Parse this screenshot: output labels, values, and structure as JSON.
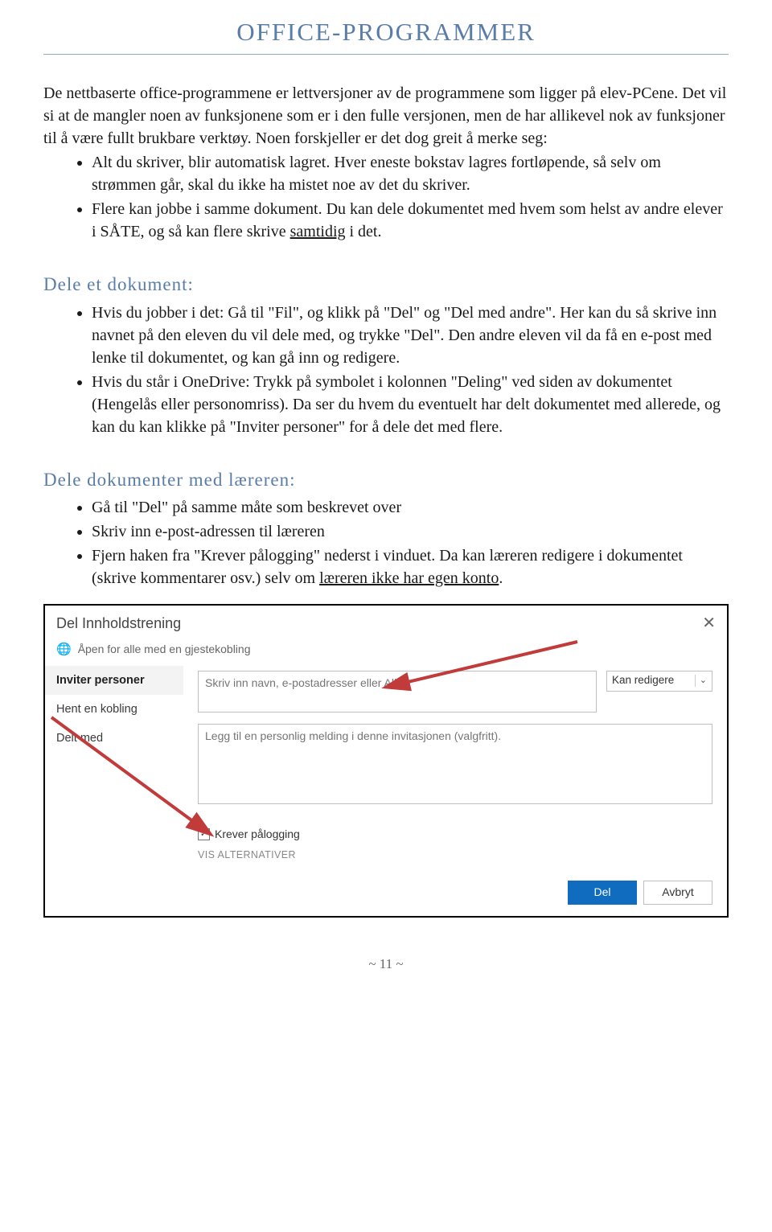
{
  "title": "OFFICE-PROGRAMMER",
  "intro": {
    "p1": "De nettbaserte office-programmene er lettversjoner av de programmene som ligger på elev-PCene. Det vil si at de mangler noen av funksjonene som er i den fulle versjonen, men de har allikevel nok av funksjoner til å være fullt brukbare verktøy. Noen forskjeller er det dog greit å merke seg:",
    "b1": "Alt du skriver, blir automatisk lagret. Hver eneste bokstav lagres fortløpende, så selv om strømmen går, skal du ikke ha mistet noe av det du skriver.",
    "b2a": "Flere kan jobbe i samme dokument. Du kan dele dokumentet med hvem som helst av andre elever i SÅTE, og så kan flere skrive ",
    "b2u": "samtidig",
    "b2b": " i det."
  },
  "section1": {
    "heading": "Dele et dokument:",
    "b1": "Hvis du jobber i det: Gå til \"Fil\", og klikk på \"Del\" og \"Del med andre\". Her kan du så skrive inn navnet på den eleven du vil dele med, og trykke \"Del\". Den andre eleven vil da få en e-post med lenke til dokumentet, og kan gå inn og redigere.",
    "b2": "Hvis du står i OneDrive: Trykk på symbolet i kolonnen \"Deling\" ved siden av dokumentet (Hengelås eller personomriss). Da ser du hvem du eventuelt har delt dokumentet med allerede, og kan du kan klikke på \"Inviter personer\" for å dele det med flere."
  },
  "section2": {
    "heading": "Dele dokumenter med læreren:",
    "b1": "Gå til \"Del\" på samme måte som beskrevet over",
    "b2": "Skriv inn e-post-adressen til læreren",
    "b3a": "Fjern haken fra \"Krever pålogging\" nederst i vinduet. Da kan læreren redigere i dokumentet (skrive kommentarer osv.) selv om ",
    "b3u": "læreren ikke har egen konto",
    "b3b": "."
  },
  "dialog": {
    "title": "Del Innholdstrening",
    "scope": "Åpen for alle med en gjestekobling",
    "nav": {
      "invite": "Inviter personer",
      "getlink": "Hent en kobling",
      "shared": "Delt med"
    },
    "name_placeholder": "Skriv inn navn, e-postadresser eller Alle.",
    "perm_label": "Kan redigere",
    "msg_placeholder": "Legg til en personlig melding i denne invitasjonen (valgfritt).",
    "checkbox_label": "Krever pålogging",
    "alt": "VIS ALTERNATIVER",
    "share_btn": "Del",
    "cancel_btn": "Avbryt"
  },
  "page_number": "~ 11 ~"
}
